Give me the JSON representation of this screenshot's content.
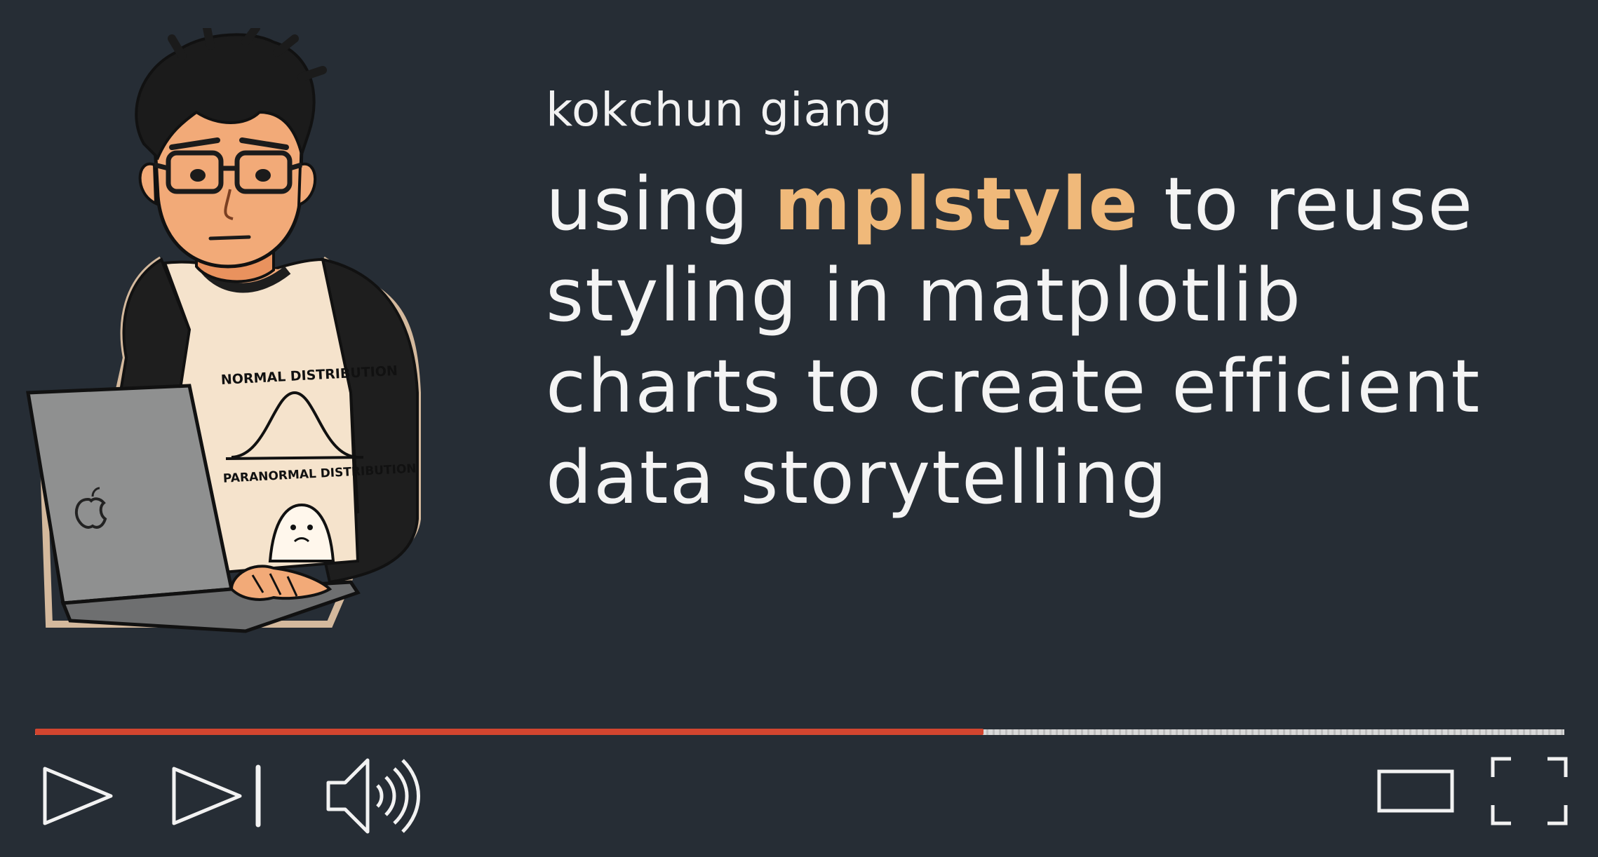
{
  "author": "kokchun giang",
  "title": {
    "line1_pre": "using ",
    "line1_highlight": "mplstyle",
    "line1_post": " to reuse",
    "line2": "styling in matplotlib",
    "line3": "charts to create efficient",
    "line4": "data storytelling"
  },
  "shirt": {
    "top_text": "NORMAL DISTRIBUTION",
    "bottom_text": "PARANORMAL DISTRIBUTION"
  },
  "player": {
    "progress_fraction": 0.62,
    "progress_color": "#d2452f",
    "icons": [
      "play-icon",
      "next-icon",
      "volume-icon",
      "theater-mode-icon",
      "fullscreen-icon"
    ]
  },
  "colors": {
    "background": "#262d35",
    "accent": "#f0b97a",
    "text": "#f4f4f4"
  }
}
